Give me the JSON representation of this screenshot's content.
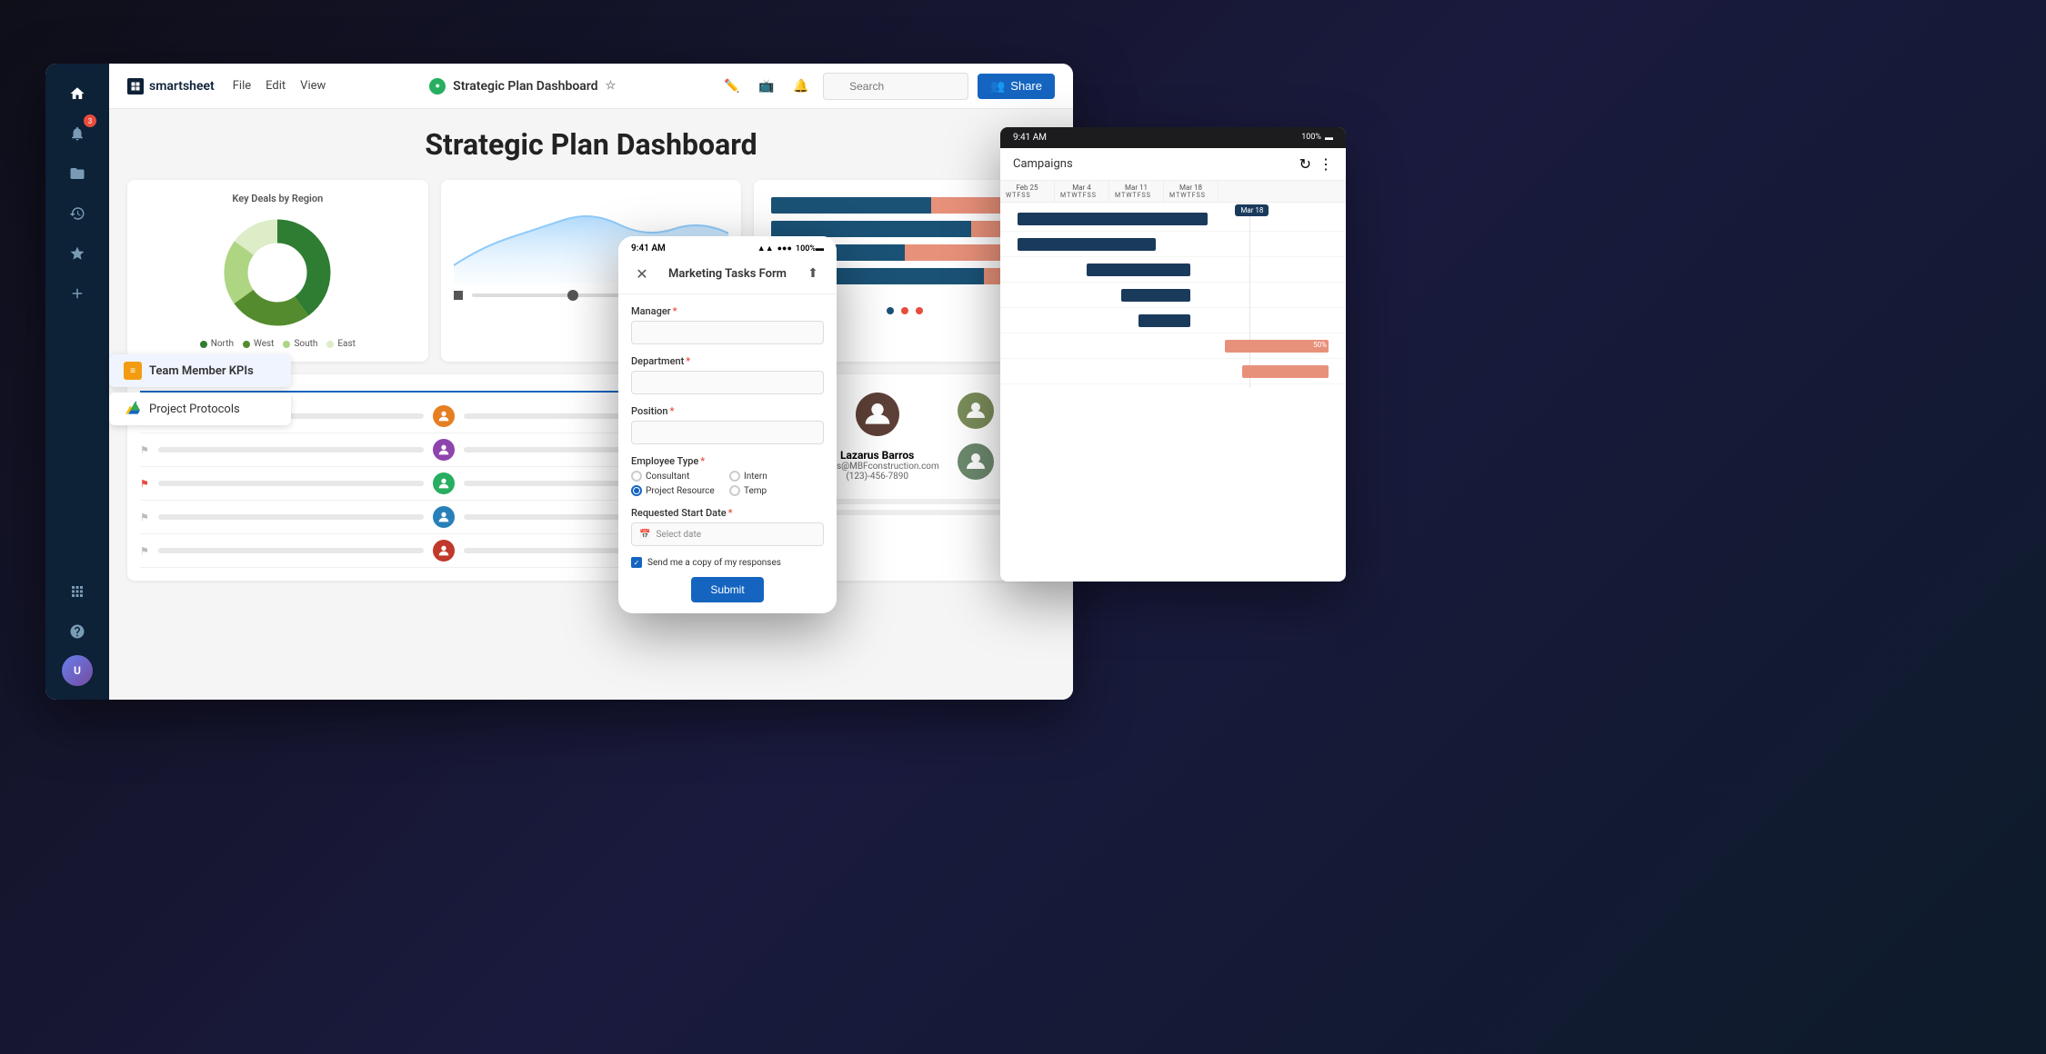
{
  "app": {
    "name": "smartsheet",
    "logo_symbol": "■"
  },
  "topbar": {
    "menu": [
      "File",
      "Edit",
      "View"
    ],
    "doc_title": "Strategic Plan Dashboard",
    "search_placeholder": "Search",
    "share_label": "Share"
  },
  "sidebar": {
    "icons": [
      "home",
      "bell",
      "folder",
      "clock",
      "star",
      "plus"
    ],
    "notification_count": "3"
  },
  "dashboard": {
    "title": "Strategic Plan Dashboard",
    "donut_chart": {
      "title": "Key Deals by Region",
      "legend": [
        {
          "label": "North",
          "color": "#2e7d32"
        },
        {
          "label": "West",
          "color": "#558b2f"
        },
        {
          "label": "South",
          "color": "#aed581"
        },
        {
          "label": "East",
          "color": "#dcedc8"
        }
      ],
      "segments": [
        {
          "value": 40,
          "color": "#2e7d32"
        },
        {
          "value": 25,
          "color": "#558b2f"
        },
        {
          "value": 20,
          "color": "#aed581"
        },
        {
          "value": 15,
          "color": "#dcedc8"
        }
      ]
    },
    "bar_chart": {
      "bars": [
        {
          "blue": 60,
          "salmon": 40
        },
        {
          "blue": 75,
          "salmon": 25
        },
        {
          "blue": 50,
          "salmon": 50
        },
        {
          "blue": 80,
          "salmon": 20
        }
      ]
    }
  },
  "dropdown_items": [
    {
      "label": "Team Member KPIs",
      "icon": "table",
      "active": true
    },
    {
      "label": "Project Protocols",
      "icon": "gdrive",
      "active": false
    }
  ],
  "mobile_form": {
    "title": "Marketing Tasks Form",
    "fields": {
      "manager": "Manager",
      "department": "Department",
      "position": "Position",
      "employee_type": "Employee Type"
    },
    "employee_options": [
      "Consultant",
      "Intern",
      "Project Resource",
      "Temp"
    ],
    "date_field": "Requested Start Date",
    "date_placeholder": "Select date",
    "checkbox_label": "Send me a copy of my responses",
    "submit_label": "Submit"
  },
  "contact": {
    "name": "Lazarus Barros",
    "email": "barros@MBFconstruction.com",
    "phone": "(123)-456-7890"
  },
  "gantt": {
    "title": "Campaigns",
    "weeks": [
      "Feb 25",
      "Mar 4",
      "Mar 11",
      "Mar 18"
    ],
    "progress_label": "50%"
  }
}
